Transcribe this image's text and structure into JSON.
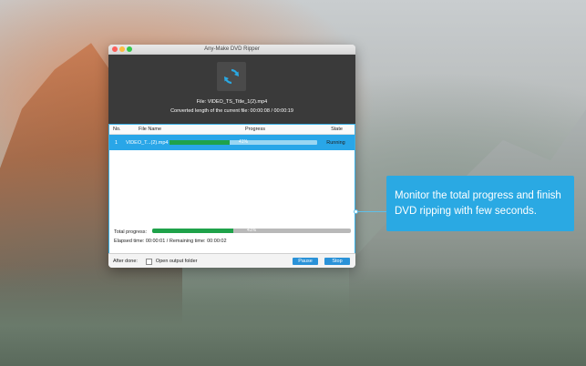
{
  "window": {
    "title": "Any-Make DVD Ripper"
  },
  "header": {
    "icon": "convert-refresh-icon",
    "file_line": "File: VIDEO_TS_Title_1(2).mp4",
    "length_line": "Converted length of the current file: 00:00:08 / 00:00:19"
  },
  "table": {
    "columns": {
      "no": "No.",
      "file_name": "File Name",
      "progress": "Progress",
      "state": "State"
    },
    "rows": [
      {
        "no": "1",
        "file_name": "VIDEO_T...(2).mp4",
        "progress_percent": 41,
        "progress_text": "41%",
        "state": "Running"
      }
    ]
  },
  "total": {
    "label": "Total progress:",
    "percent": 41,
    "text": "41%",
    "time_line": "Elapsed time: 00:00:01 / Remaining time: 00:00:02"
  },
  "footer": {
    "after_done_label": "After done:",
    "open_folder_label": "Open output folder",
    "open_folder_checked": false,
    "pause_label": "Pause",
    "stop_label": "Stop"
  },
  "callout": {
    "text": "Monitor the total progress and finish DVD ripping with few seconds."
  },
  "colors": {
    "accent": "#2aa9e3",
    "progress_green": "#1fa24a",
    "header_dark": "#3a3a3a"
  }
}
